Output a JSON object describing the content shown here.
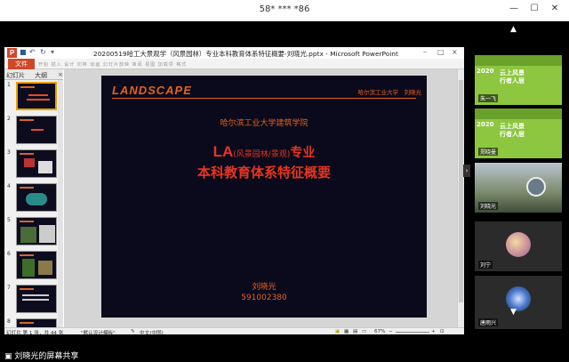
{
  "window": {
    "title": "58* *** *86",
    "minimize": "—",
    "maximize": "☐",
    "close": "✕"
  },
  "ppt": {
    "logo": "P",
    "doc_title": "20200519哈工大景观学（风景园林）专业本科教育体系特征概要-刘晓光.pptx - Microsoft PowerPoint",
    "file_tab": "文件",
    "ribbon_tabs": "开始  插入  设计  切换  动画  幻灯片放映  审阅  视图  加载项  格式",
    "panel_tabs": [
      "幻灯片",
      "大纲"
    ],
    "panel_close": "×",
    "thumb_numbers": [
      "1",
      "2",
      "3",
      "4",
      "5",
      "6",
      "7",
      "8"
    ],
    "status": {
      "slide_info": "幻灯片 第 1 张，共 44 张",
      "theme": "\"默认设计模板\"",
      "language": "中文(中国)",
      "zoom": "67%"
    }
  },
  "slide": {
    "brand": "LANDSCAPE",
    "header_right": "哈尔滨工业大学　刘晓光",
    "institute": "哈尔滨工业大学建筑学院",
    "title_la": "LA",
    "title_paren": "(风景园林/景观)",
    "title_rest": "专业",
    "subtitle": "本科教育体系特征概要",
    "author": "刘晓光",
    "number": "591002380"
  },
  "participants": [
    {
      "name": "朱一飞",
      "kind": "banner"
    },
    {
      "name": "郑晓曼",
      "kind": "banner"
    },
    {
      "name": "刘晓光",
      "kind": "photo"
    },
    {
      "name": "刘宁",
      "kind": "avatar"
    },
    {
      "name": "唐雨兴",
      "kind": "avatar"
    }
  ],
  "banner": {
    "year": "2020",
    "line1": "云上风景",
    "line2": "行者人居"
  },
  "nav": {
    "up": "▲",
    "down": "▼",
    "collapse": "›"
  },
  "share_label": "刘晓光的屏幕共享",
  "colors": {
    "accent_orange": "#e6611c",
    "title_red": "#e8351f",
    "ppt_brand": "#d24726",
    "banner_green": "#8dc63f"
  }
}
